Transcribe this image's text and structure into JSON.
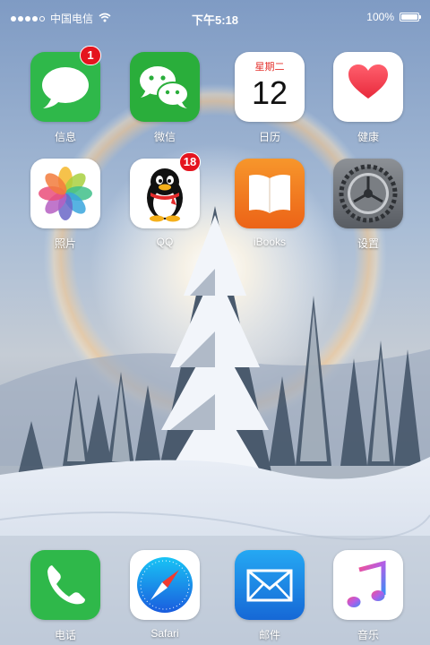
{
  "status_bar": {
    "carrier": "中国电信",
    "time": "下午5:18",
    "battery": "100%",
    "battery_level": 1.0,
    "signal_bars": 4,
    "icons": [
      "signal-dots-icon",
      "wifi-icon",
      "battery-icon"
    ]
  },
  "apps": [
    {
      "id": "messages",
      "label": "信息",
      "icon": "speech-bubble-icon",
      "badge": "1"
    },
    {
      "id": "wechat",
      "label": "微信",
      "icon": "wechat-bubbles-icon"
    },
    {
      "id": "calendar",
      "label": "日历",
      "icon": "calendar-icon",
      "weekday": "星期二",
      "day": "12"
    },
    {
      "id": "health",
      "label": "健康",
      "icon": "heart-icon"
    },
    {
      "id": "photos",
      "label": "照片",
      "icon": "photos-flower-icon"
    },
    {
      "id": "qq",
      "label": "QQ",
      "icon": "penguin-icon",
      "badge": "18"
    },
    {
      "id": "ibooks",
      "label": "iBooks",
      "icon": "open-book-icon"
    },
    {
      "id": "settings",
      "label": "设置",
      "icon": "gear-icon"
    }
  ],
  "dock": [
    {
      "id": "phone",
      "label": "电话",
      "icon": "phone-handset-icon"
    },
    {
      "id": "safari",
      "label": "Safari",
      "icon": "compass-icon"
    },
    {
      "id": "mail",
      "label": "邮件",
      "icon": "envelope-icon"
    },
    {
      "id": "music",
      "label": "音乐",
      "icon": "music-note-icon"
    }
  ],
  "colors": {
    "badge": "#e5141e",
    "messages_green": "#2fb84a",
    "wechat_green": "#2aae3b",
    "ibooks_orange": "#f0781a",
    "health_heart": "#ee3b4b",
    "mail_blue": "#1e7fe0"
  },
  "wallpaper": "snowy-forest-halo"
}
